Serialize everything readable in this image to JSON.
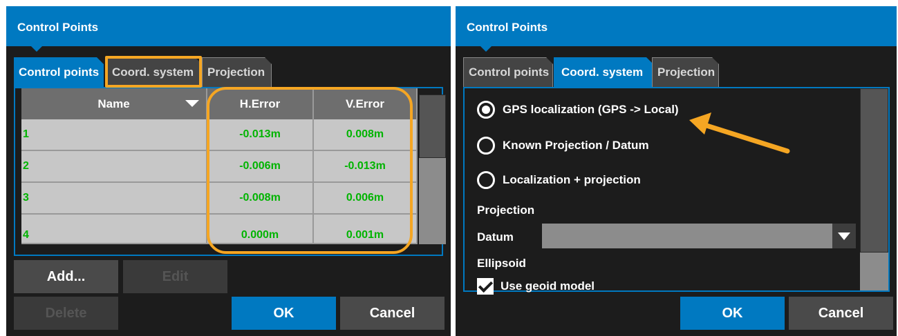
{
  "colors": {
    "accent": "#0079c1",
    "highlight": "#f5a623",
    "value_green": "#00b400",
    "panel_bg": "#1c1c1c"
  },
  "left_panel": {
    "title": "Control Points",
    "tabs": [
      {
        "label": "Control points",
        "active": true
      },
      {
        "label": "Coord. system",
        "active": false
      },
      {
        "label": "Projection",
        "active": false
      }
    ],
    "table": {
      "headers": {
        "name": "Name",
        "h_error": "H.Error",
        "v_error": "V.Error"
      },
      "rows": [
        {
          "name": "1",
          "h_error": "-0.013m",
          "v_error": "0.008m"
        },
        {
          "name": "2",
          "h_error": "-0.006m",
          "v_error": "-0.013m"
        },
        {
          "name": "3",
          "h_error": "-0.008m",
          "v_error": "0.006m"
        },
        {
          "name": "4",
          "h_error": "0.000m",
          "v_error": "0.001m"
        }
      ]
    },
    "buttons": {
      "add": "Add...",
      "edit": "Edit",
      "delete": "Delete",
      "ok": "OK",
      "cancel": "Cancel"
    }
  },
  "right_panel": {
    "title": "Control Points",
    "tabs": [
      {
        "label": "Control points",
        "active": false
      },
      {
        "label": "Coord. system",
        "active": true
      },
      {
        "label": "Projection",
        "active": false
      }
    ],
    "options": [
      {
        "label": "GPS localization (GPS -> Local)",
        "selected": true
      },
      {
        "label": "Known Projection / Datum",
        "selected": false
      },
      {
        "label": "Localization + projection",
        "selected": false
      }
    ],
    "projection_label": "Projection",
    "datum_label": "Datum",
    "datum_value": "",
    "ellipsoid_label": "Ellipsoid",
    "geoid_label": "Use geoid model",
    "buttons": {
      "ok": "OK",
      "cancel": "Cancel"
    }
  }
}
